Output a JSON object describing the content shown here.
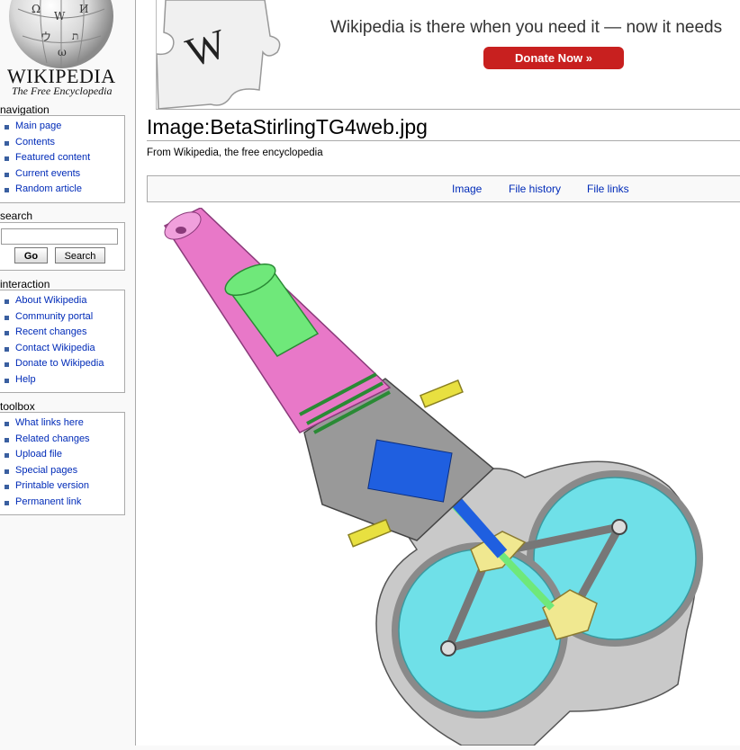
{
  "logo": {
    "wordmark": "WIKIPEDIA",
    "tagline": "The Free Encyclopedia"
  },
  "sidebar": {
    "navigation": {
      "title": "navigation",
      "items": [
        {
          "label": "Main page"
        },
        {
          "label": "Contents"
        },
        {
          "label": "Featured content"
        },
        {
          "label": "Current events"
        },
        {
          "label": "Random article"
        }
      ]
    },
    "search": {
      "title": "search",
      "input_value": "",
      "go_label": "Go",
      "search_label": "Search"
    },
    "interaction": {
      "title": "interaction",
      "items": [
        {
          "label": "About Wikipedia"
        },
        {
          "label": "Community portal"
        },
        {
          "label": "Recent changes"
        },
        {
          "label": "Contact Wikipedia"
        },
        {
          "label": "Donate to Wikipedia"
        },
        {
          "label": "Help"
        }
      ]
    },
    "toolbox": {
      "title": "toolbox",
      "items": [
        {
          "label": "What links here"
        },
        {
          "label": "Related changes"
        },
        {
          "label": "Upload file"
        },
        {
          "label": "Special pages"
        },
        {
          "label": "Printable version"
        },
        {
          "label": "Permanent link"
        }
      ]
    }
  },
  "banner": {
    "text": "Wikipedia is there when you need it — now it needs",
    "donate_label": "Donate Now »",
    "button_color": "#c8201f"
  },
  "page": {
    "title": "Image:BetaStirlingTG4web.jpg",
    "subtitle": "From Wikipedia, the free encyclopedia",
    "tabs": [
      {
        "label": "Image"
      },
      {
        "label": "File history"
      },
      {
        "label": "File links"
      }
    ]
  },
  "image": {
    "subject": "beta-stirling-engine-cutaway",
    "colors": {
      "cylinder": "#e878c8",
      "displacer": "#6fe87a",
      "piston": "#1f5fe0",
      "flywheel": "#6fe0e8",
      "housing": "#bdbdbd",
      "bolts": "#e8e040",
      "links": "#f0e890"
    }
  }
}
